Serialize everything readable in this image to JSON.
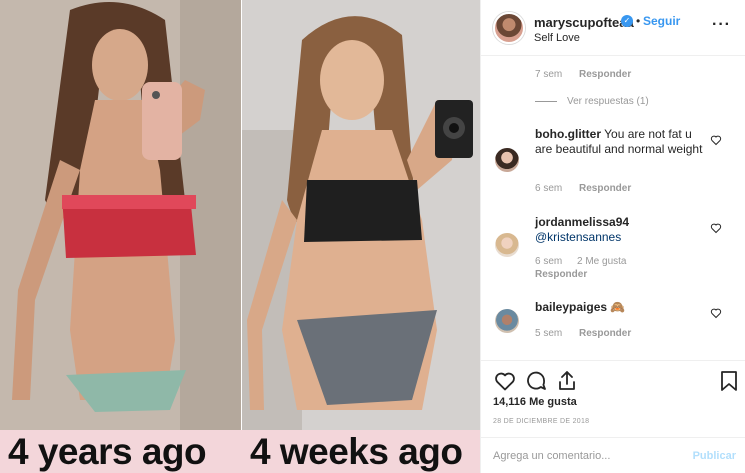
{
  "post": {
    "caption_left": "4 years ago",
    "caption_right": "4 weeks ago"
  },
  "header": {
    "username": "maryscupofteaa",
    "verified_icon": "verified-badge-icon",
    "dot": "•",
    "follow_label": "Seguir",
    "location": "Self Love",
    "more_icon": "ellipsis-icon"
  },
  "comments": {
    "top_meta": {
      "time": "7 sem",
      "reply": "Responder"
    },
    "view_replies": "Ver respuestas (1)",
    "items": [
      {
        "username": "boho.glitter",
        "text": "You are not fat u are beautiful and normal weight",
        "time": "6 sem",
        "reply": "Responder",
        "likes": ""
      },
      {
        "username": "jordanmelissa94",
        "mention": "@kristensannes",
        "time": "6 sem",
        "likes": "2 Me gusta",
        "reply": "Responder"
      },
      {
        "username": "baileypaiges",
        "emoji": "🙈",
        "time": "5 sem",
        "reply": "Responder"
      }
    ]
  },
  "actions": {
    "like_icon": "heart-icon",
    "comment_icon": "comment-icon",
    "share_icon": "share-icon",
    "save_icon": "bookmark-icon",
    "likes_count": "14,116 Me gusta",
    "date": "28 DE DICIEMBRE DE 2018"
  },
  "composer": {
    "placeholder": "Agrega un comentario...",
    "post_label": "Publicar"
  },
  "colors": {
    "accent": "#3897f0",
    "caption_bg": "#f3d6da",
    "muted": "#999999"
  }
}
